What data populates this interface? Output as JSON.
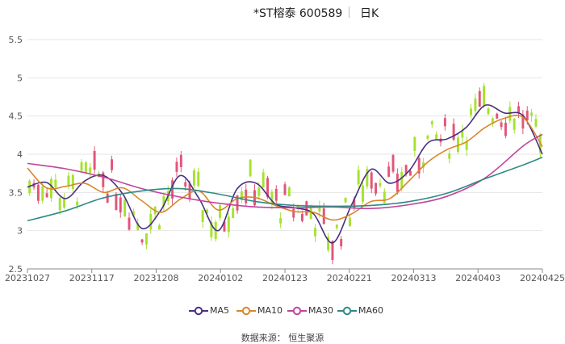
{
  "title": {
    "stock": "*ST榕泰 600589",
    "period": "日K"
  },
  "source": "数据来源： 恒生聚源",
  "colors": {
    "up": "#e2557a",
    "down": "#a6e22e",
    "MA5": "#4a2f80",
    "MA10": "#d9862a",
    "MA30": "#c0449a",
    "MA60": "#2e8a85",
    "grid": "#e6e6e6",
    "axis": "#888888"
  },
  "chart_data": {
    "type": "line",
    "subtype": "candlestick_with_moving_averages",
    "x_tick_labels": [
      "20231027",
      "20231117",
      "20231208",
      "20240102",
      "20240123",
      "20240221",
      "20240313",
      "20240403",
      "20240425"
    ],
    "y_tick_labels": [
      "2.5",
      "3",
      "3.5",
      "4",
      "4.5",
      "5",
      "5.5"
    ],
    "ylim": [
      2.5,
      5.5
    ],
    "grid": true,
    "legend_position": "bottom",
    "n_days": 119,
    "series": [
      {
        "name": "MA5",
        "points": [
          [
            0,
            3.57
          ],
          [
            6,
            3.63
          ],
          [
            12,
            3.42
          ],
          [
            18,
            3.65
          ],
          [
            24,
            3.72
          ],
          [
            30,
            3.48
          ],
          [
            36,
            3.03
          ],
          [
            42,
            3.27
          ],
          [
            48,
            3.72
          ],
          [
            54,
            3.42
          ],
          [
            60,
            3.0
          ],
          [
            66,
            3.55
          ],
          [
            72,
            3.62
          ],
          [
            78,
            3.35
          ],
          [
            84,
            3.3
          ],
          [
            90,
            3.22
          ],
          [
            96,
            2.84
          ],
          [
            102,
            3.34
          ],
          [
            108,
            3.8
          ],
          [
            114,
            3.62
          ],
          [
            120,
            3.78
          ],
          [
            126,
            4.15
          ],
          [
            132,
            4.2
          ],
          [
            138,
            4.35
          ],
          [
            144,
            4.64
          ],
          [
            150,
            4.54
          ],
          [
            156,
            4.5
          ],
          [
            162,
            4.0
          ]
        ]
      },
      {
        "name": "MA10",
        "points": [
          [
            0,
            3.82
          ],
          [
            6,
            3.56
          ],
          [
            12,
            3.58
          ],
          [
            18,
            3.62
          ],
          [
            24,
            3.5
          ],
          [
            30,
            3.56
          ],
          [
            36,
            3.39
          ],
          [
            42,
            3.24
          ],
          [
            48,
            3.41
          ],
          [
            54,
            3.52
          ],
          [
            60,
            3.27
          ],
          [
            66,
            3.42
          ],
          [
            72,
            3.43
          ],
          [
            78,
            3.33
          ],
          [
            84,
            3.25
          ],
          [
            90,
            3.24
          ],
          [
            96,
            3.14
          ],
          [
            102,
            3.22
          ],
          [
            108,
            3.38
          ],
          [
            114,
            3.42
          ],
          [
            120,
            3.65
          ],
          [
            126,
            3.9
          ],
          [
            132,
            4.06
          ],
          [
            138,
            4.16
          ],
          [
            144,
            4.35
          ],
          [
            150,
            4.47
          ],
          [
            156,
            4.48
          ],
          [
            162,
            4.1
          ]
        ]
      },
      {
        "name": "MA30",
        "points": [
          [
            0,
            3.88
          ],
          [
            12,
            3.81
          ],
          [
            24,
            3.7
          ],
          [
            36,
            3.55
          ],
          [
            48,
            3.44
          ],
          [
            60,
            3.36
          ],
          [
            72,
            3.31
          ],
          [
            84,
            3.3
          ],
          [
            96,
            3.31
          ],
          [
            108,
            3.29
          ],
          [
            120,
            3.34
          ],
          [
            132,
            3.45
          ],
          [
            144,
            3.69
          ],
          [
            156,
            4.11
          ],
          [
            162,
            4.26
          ]
        ]
      },
      {
        "name": "MA60",
        "points": [
          [
            0,
            3.13
          ],
          [
            12,
            3.26
          ],
          [
            24,
            3.43
          ],
          [
            36,
            3.52
          ],
          [
            48,
            3.55
          ],
          [
            60,
            3.48
          ],
          [
            72,
            3.38
          ],
          [
            84,
            3.33
          ],
          [
            96,
            3.32
          ],
          [
            108,
            3.33
          ],
          [
            120,
            3.38
          ],
          [
            132,
            3.49
          ],
          [
            144,
            3.68
          ],
          [
            156,
            3.86
          ],
          [
            162,
            3.96
          ]
        ]
      }
    ]
  }
}
